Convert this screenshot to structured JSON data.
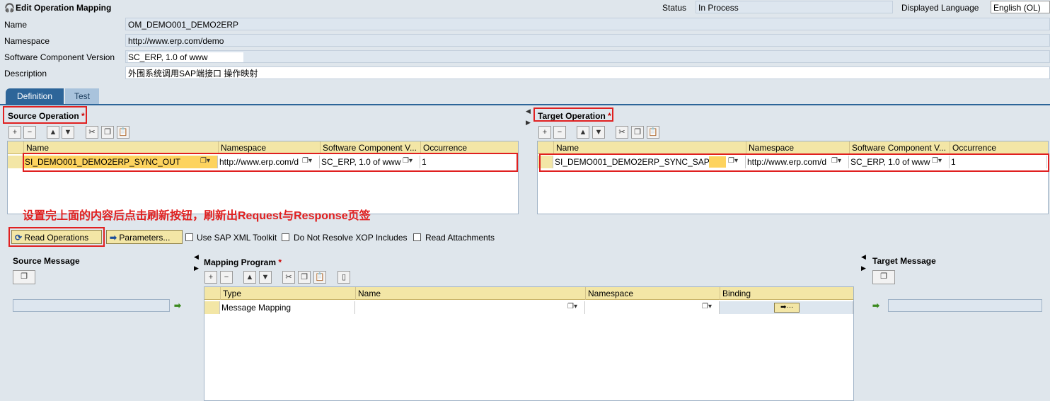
{
  "header": {
    "title": "Edit Operation Mapping",
    "status_label": "Status",
    "status_value": "In Process",
    "language_label": "Displayed Language",
    "language_value": "English (OL)"
  },
  "form": {
    "name_label": "Name",
    "name_value": "OM_DEMO001_DEMO2ERP",
    "namespace_label": "Namespace",
    "namespace_value": "http://www.erp.com/demo",
    "swcv_label": "Software Component Version",
    "swcv_value": "SC_ERP, 1.0 of www",
    "desc_label": "Description",
    "desc_value": "外围系统调用SAP端接口 操作映射"
  },
  "tabs": [
    {
      "label": "Definition"
    },
    {
      "label": "Test"
    }
  ],
  "source_op": {
    "title": "Source Operation",
    "required": "*",
    "columns": [
      "Name",
      "Namespace",
      "Software Component V...",
      "Occurrence"
    ],
    "row": {
      "name": "SI_DEMO001_DEMO2ERP_SYNC_OUT",
      "namespace": "http://www.erp.com/d",
      "swcv": "SC_ERP, 1.0 of www",
      "occurrence": "1"
    }
  },
  "target_op": {
    "title": "Target Operation",
    "required": "*",
    "columns": [
      "Name",
      "Namespace",
      "Software Component V...",
      "Occurrence"
    ],
    "row": {
      "name": "SI_DEMO001_DEMO2ERP_SYNC_SAP",
      "namespace": "http://www.erp.com/d",
      "swcv": "SC_ERP, 1.0 of www",
      "occurrence": "1"
    }
  },
  "annotation": "设置完上面的内容后点击刷新按钮，刷新出Request与Response页签",
  "actions": {
    "read_operations": "Read Operations",
    "parameters": "Parameters...",
    "use_sap_xml": "Use SAP XML Toolkit",
    "do_not_resolve": "Do Not Resolve XOP Includes",
    "read_attachments": "Read Attachments"
  },
  "source_message": {
    "title": "Source Message"
  },
  "target_message": {
    "title": "Target Message"
  },
  "mapping_program": {
    "title": "Mapping Program",
    "required": "*",
    "columns": [
      "Type",
      "Name",
      "Namespace",
      "Binding"
    ],
    "row": {
      "type": "Message Mapping",
      "name": "",
      "namespace": ""
    }
  },
  "colors": {
    "highlight": "#fdd35e",
    "header_row": "#f3e6a6",
    "red_box": "#e02020",
    "annotation": "#e02020"
  }
}
